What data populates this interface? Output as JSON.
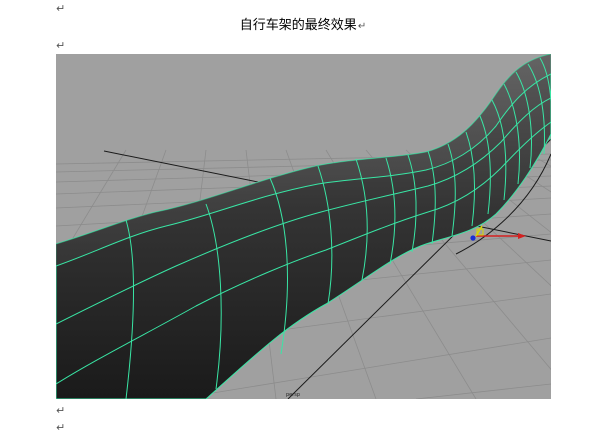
{
  "document": {
    "caption": "自行车架的最终效果",
    "paragraph_mark": "↵"
  },
  "viewport": {
    "background_color": "#a0a0a0",
    "grid_color": "#8a8a8a",
    "mesh_wire_color": "#39e6a5",
    "axis_x_color": "#d42020",
    "axis_z_color": "#1a2fd6",
    "axis_y_color": "#d8d800",
    "hud_label": "persp"
  }
}
